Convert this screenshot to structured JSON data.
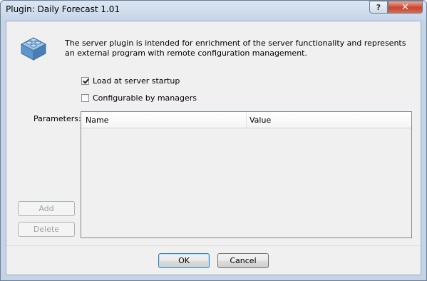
{
  "window": {
    "title": "Plugin: Daily Forecast 1.01",
    "help_label": "?",
    "close_label": "✕"
  },
  "description": "The server plugin is intended for enrichment of the server functionality and represents an external program with remote configuration management.",
  "options": [
    {
      "label": "Load at server startup",
      "checked": true
    },
    {
      "label": "Configurable by managers",
      "checked": false
    }
  ],
  "parameters": {
    "label": "Parameters:",
    "columns": [
      "Name",
      "Value"
    ],
    "rows": [],
    "add_label": "Add",
    "delete_label": "Delete"
  },
  "buttons": {
    "ok": "OK",
    "cancel": "Cancel"
  },
  "colors": {
    "accent": "#3c7fb1",
    "icon_blue": "#6fa3d6",
    "close_red": "#c8452f"
  }
}
